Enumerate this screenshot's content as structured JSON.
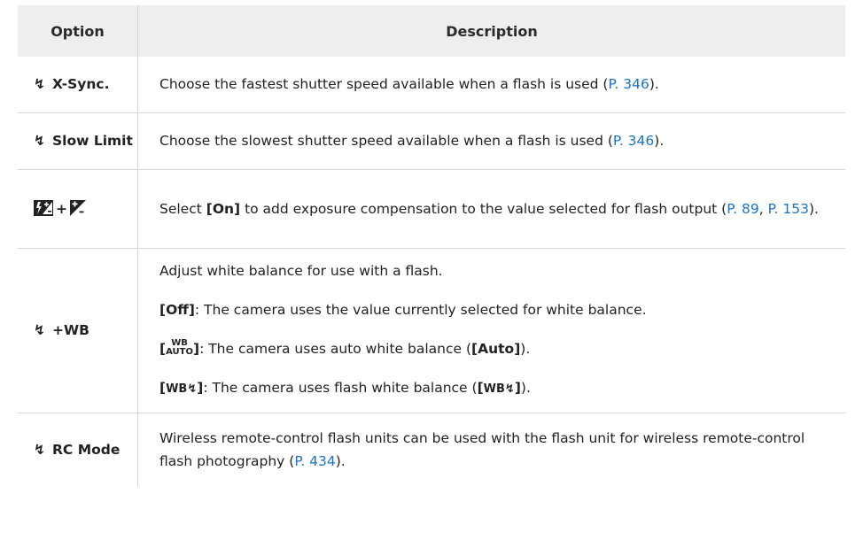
{
  "table": {
    "headers": {
      "option": "Option",
      "description": "Description"
    },
    "rows": [
      {
        "option": "X-Sync.",
        "desc_prefix": "Choose the fastest shutter speed available when a flash is used (",
        "link": "P. 346",
        "desc_suffix": ")."
      },
      {
        "option": "Slow Limit",
        "desc_prefix": "Choose the slowest shutter speed available when a flash is used (",
        "link": "P. 346",
        "desc_suffix": ")."
      },
      {
        "option": "+",
        "desc_prefix": "Select ",
        "bold": "[On]",
        "desc_mid": " to add exposure compensation to the value selected for flash output (",
        "link1": "P. 89",
        "sep": ", ",
        "link2": "P. 153",
        "desc_suffix": ")."
      },
      {
        "option": "+WB",
        "intro": "Adjust white balance for use with a flash.",
        "off_label": "[Off]",
        "off_text": ": The camera uses the value currently selected for white balance.",
        "auto_wb": "WB",
        "auto_auto": "AUTO",
        "auto_text": ": The camera uses auto white balance (",
        "auto_bold": "[Auto]",
        "auto_end": ").",
        "flash_wb": "WB",
        "flash_text": ": The camera uses flash white balance (",
        "flash_end": ")."
      },
      {
        "option": "RC Mode",
        "desc_prefix": "Wireless remote-control flash units can be used with the flash unit for wireless remote-control flash photography (",
        "link": "P. 434",
        "desc_suffix": ")."
      }
    ]
  },
  "icons": {
    "flash": "flash-bolt-icon",
    "exposure": "exposure-comp-icon",
    "flash_exposure": "flash-exposure-comp-icon"
  },
  "colors": {
    "link": "#1a73c8",
    "header_bg": "#eeeeee"
  }
}
